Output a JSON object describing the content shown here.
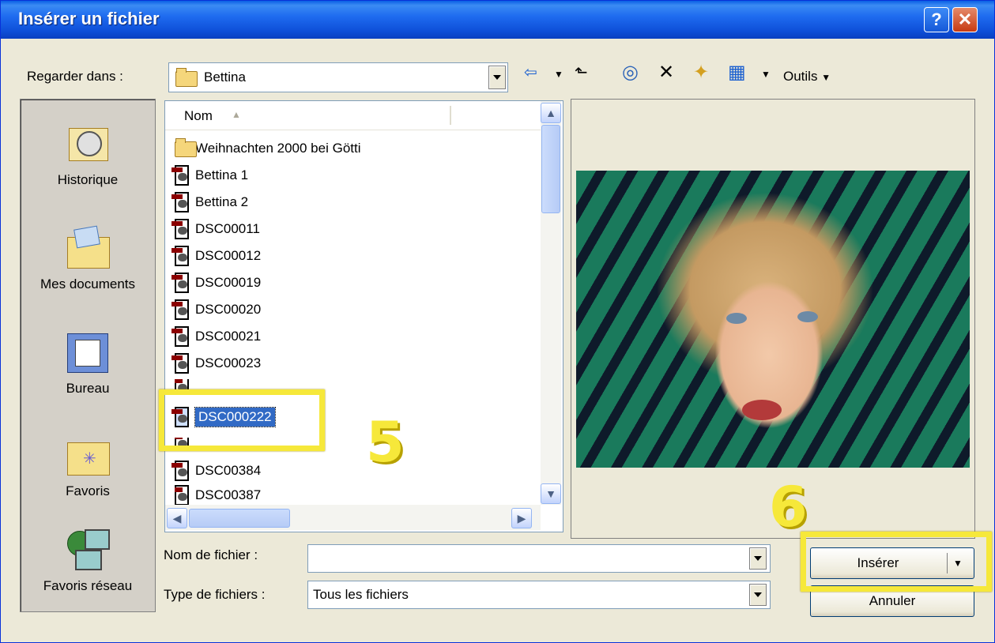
{
  "window": {
    "title": "Insérer un fichier",
    "help_glyph": "?",
    "close_glyph": "✕"
  },
  "toolbar": {
    "look_in_label": "Regarder dans :",
    "look_in_value": "Bettina",
    "back_glyph": "⇦",
    "up_glyph": "⬑",
    "search_glyph": "◎",
    "delete_glyph": "✕",
    "new_folder_glyph": "✦",
    "views_glyph": "▦",
    "tools_label": "Outils"
  },
  "places": [
    {
      "label": "Historique",
      "icon": "history-icon"
    },
    {
      "label": "Mes documents",
      "icon": "my-documents-icon"
    },
    {
      "label": "Bureau",
      "icon": "desktop-icon"
    },
    {
      "label": "Favoris",
      "icon": "favorites-icon"
    },
    {
      "label": "Favoris réseau",
      "icon": "network-places-icon"
    }
  ],
  "file_list": {
    "column_header": "Nom",
    "items": [
      {
        "name": "Weihnachten 2000 bei Götti",
        "type": "folder"
      },
      {
        "name": "Bettina 1",
        "type": "image"
      },
      {
        "name": "Bettina 2",
        "type": "image"
      },
      {
        "name": "DSC00011",
        "type": "image"
      },
      {
        "name": "DSC00012",
        "type": "image"
      },
      {
        "name": "DSC00019",
        "type": "image"
      },
      {
        "name": "DSC00020",
        "type": "image"
      },
      {
        "name": "DSC00021",
        "type": "image"
      },
      {
        "name": "DSC00023",
        "type": "image"
      },
      {
        "name": "DSC000222",
        "type": "image",
        "selected": true
      },
      {
        "name": "DSC00384",
        "type": "image"
      },
      {
        "name": "DSC00387",
        "type": "image"
      }
    ]
  },
  "filename_label": "Nom de fichier :",
  "filename_value": "",
  "filetype_label": "Type de fichiers :",
  "filetype_value": "Tous les fichiers",
  "buttons": {
    "insert": "Insérer",
    "cancel": "Annuler"
  },
  "annotations": {
    "step5": "5",
    "step6": "6"
  },
  "colors": {
    "highlight": "#f6e83a",
    "title_bar": "#0a5fe5",
    "selection": "#316ac5"
  }
}
